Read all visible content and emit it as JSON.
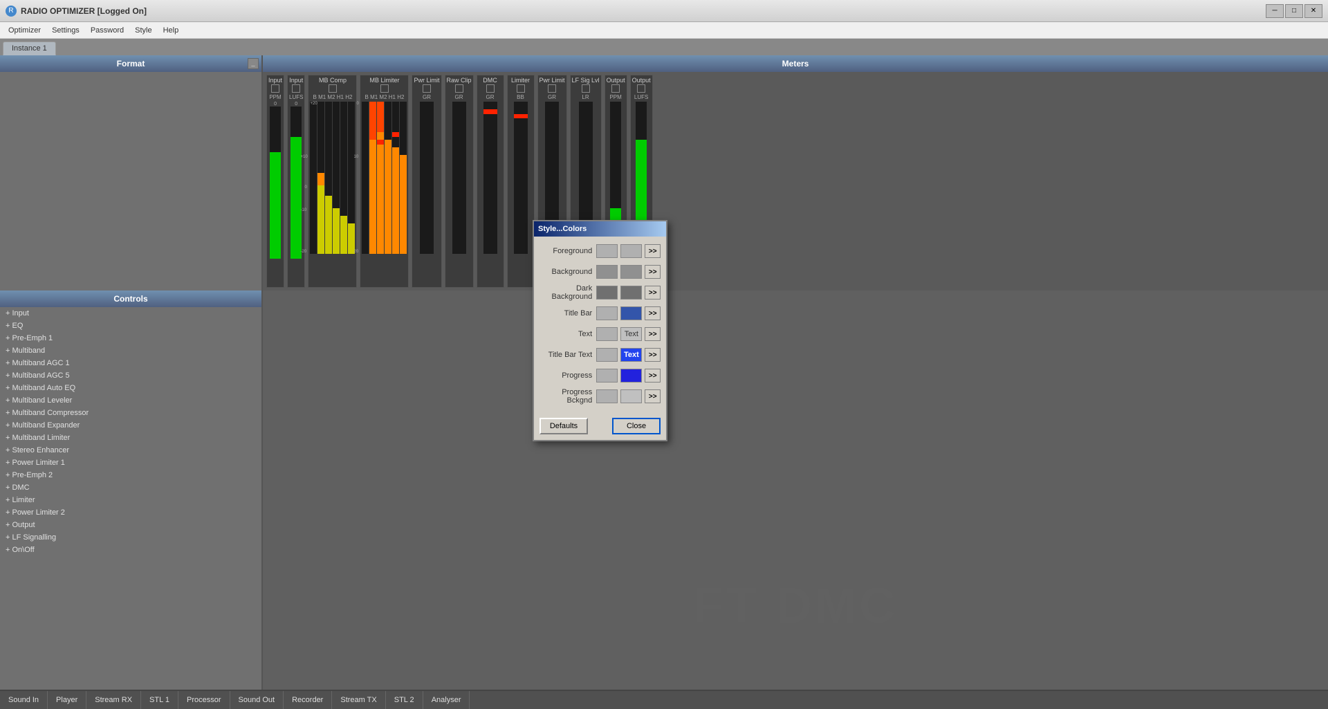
{
  "titleBar": {
    "appName": "RADIO OPTIMIZER [Logged On]",
    "icon": "R"
  },
  "menuBar": {
    "items": [
      "Optimizer",
      "Settings",
      "Password",
      "Style",
      "Help"
    ]
  },
  "tabs": [
    {
      "label": "Instance 1",
      "active": true
    }
  ],
  "panels": {
    "format": {
      "title": "Format"
    },
    "meters": {
      "title": "Meters"
    },
    "controls": {
      "title": "Controls",
      "items": [
        "+ Input",
        "+ EQ",
        "+ Pre-Emph 1",
        "+ Multiband",
        "+ Multiband AGC 1",
        "+ Multiband AGC 5",
        "+ Multiband Auto EQ",
        "+ Multiband Leveler",
        "+ Multiband Compressor",
        "+ Multiband Expander",
        "+ Multiband Limiter",
        "+ Stereo Enhancer",
        "+ Power Limiter 1",
        "+ Pre-Emph 2",
        "+ DMC",
        "+ Limiter",
        "+ Power Limiter 2",
        "+ Output",
        "+ LF Signalling",
        "+ On\\Off"
      ]
    }
  },
  "metersData": [
    {
      "label": "Input",
      "sublabel": "PPM",
      "type": "ppm"
    },
    {
      "label": "Input",
      "sublabel": "LUFS",
      "type": "lufs"
    },
    {
      "label": "MB Comp",
      "sublabel": "",
      "type": "multi5"
    },
    {
      "label": "MB Limiter",
      "sublabel": "",
      "type": "multi5"
    },
    {
      "label": "Pwr Limit",
      "sublabel": "GR",
      "type": "single"
    },
    {
      "label": "Raw Clip",
      "sublabel": "GR",
      "type": "single"
    },
    {
      "label": "DMC",
      "sublabel": "GR",
      "type": "single"
    },
    {
      "label": "Limiter",
      "sublabel": "BB",
      "type": "single"
    },
    {
      "label": "Pwr Limit",
      "sublabel": "GR",
      "type": "single"
    },
    {
      "label": "LF Sig Lvl",
      "sublabel": "LR",
      "type": "single"
    },
    {
      "label": "Output",
      "sublabel": "PPM",
      "type": "ppm"
    },
    {
      "label": "Output",
      "sublabel": "LUFS",
      "type": "lufs"
    }
  ],
  "watermark": "FT DMC",
  "statusBar": {
    "items": [
      "Sound In",
      "Player",
      "Stream RX",
      "STL 1",
      "Processor",
      "Sound Out",
      "Recorder",
      "Stream TX",
      "STL 2",
      "Analyser"
    ]
  },
  "dialog": {
    "title": "Style...Colors",
    "rows": [
      {
        "label": "Foreground",
        "swatchColor": "#b0b0b0",
        "previewColor": "#b0b0b0",
        "previewText": ""
      },
      {
        "label": "Background",
        "swatchColor": "#909090",
        "previewColor": "#909090",
        "previewText": ""
      },
      {
        "label": "Dark Background",
        "swatchColor": "#707070",
        "previewColor": "#707070",
        "previewText": ""
      },
      {
        "label": "Title Bar",
        "swatchColor": "#b0b0b0",
        "previewColor": "#4466aa",
        "previewText": ""
      },
      {
        "label": "Text",
        "swatchColor": "#b0b0b0",
        "previewColor": "#c0c0c0",
        "previewText": "Text"
      },
      {
        "label": "Title Bar Text",
        "swatchColor": "#b0b0b0",
        "previewColor": "#2244ee",
        "previewText": "Text"
      },
      {
        "label": "Progress",
        "swatchColor": "#b0b0b0",
        "previewColor": "#2222dd",
        "previewText": ""
      },
      {
        "label": "Progress Bckgnd",
        "swatchColor": "#b0b0b0",
        "previewColor": "#b0b0b0",
        "previewText": ""
      }
    ],
    "buttons": {
      "defaults": "Defaults",
      "close": "Close"
    }
  }
}
